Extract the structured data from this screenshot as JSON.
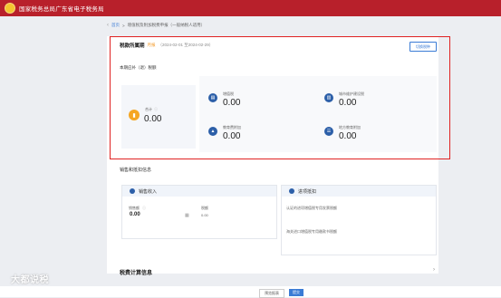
{
  "header": {
    "title": "国家税务总局广东省电子税务局"
  },
  "breadcrumb": {
    "back": "‹",
    "home": "首页",
    "sep1": ">",
    "item1": "增值税及附加税费申报（一般纳税人适用）",
    "sep2": ">",
    "item2": ""
  },
  "period": {
    "label": "税款所属期",
    "badge": "月报",
    "dates": "（2024-02-01 至2024-02-29）",
    "switch_button": "切换税种"
  },
  "summary": {
    "title": "本期应补（退）税额",
    "total_label": "合计",
    "total_value": "0.00",
    "items": [
      {
        "label": "增值税",
        "value": "0.00",
        "icon": "document-icon"
      },
      {
        "label": "城市维护建设税",
        "value": "0.00",
        "icon": "building-icon"
      },
      {
        "label": "教育费附加",
        "value": "0.00",
        "icon": "graduation-icon"
      },
      {
        "label": "地方教育附加",
        "value": "0.00",
        "icon": "list-icon"
      }
    ]
  },
  "sales": {
    "title": "销售和抵扣信息",
    "income": {
      "title": "销售收入",
      "sales_label": "销售额",
      "sales_value": "0.00",
      "tax_label": "税额",
      "tax_value": "0.00"
    },
    "deduction": {
      "title": "进项抵扣",
      "line1": "认证的进项增值税专用发票税额",
      "line2": "海关进口增值税专用缴款书税额"
    }
  },
  "calc": {
    "title": "税费计算信息",
    "arrow": "›"
  },
  "footer": {
    "prev": "预览报表",
    "next": "提交"
  },
  "watermark": "大都说税"
}
